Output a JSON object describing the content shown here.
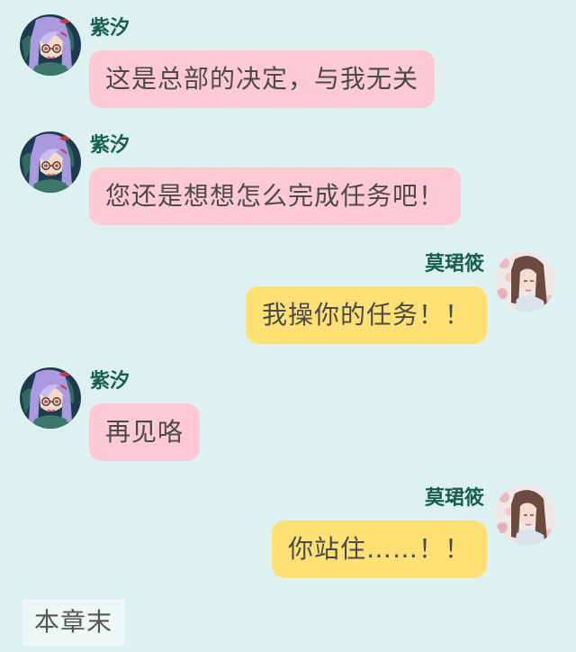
{
  "characters": {
    "zixi": {
      "name": "紫汐",
      "avatar_icon": "purple-hair-girl-avatar-icon"
    },
    "mojunxiao": {
      "name": "莫珺筱",
      "avatar_icon": "brown-hair-girl-avatar-icon"
    }
  },
  "messages": [
    {
      "sender": "紫汐",
      "side": "left",
      "text": "这是总部的决定，与我无关",
      "bubble_color": "#ffcad5"
    },
    {
      "sender": "紫汐",
      "side": "left",
      "text": "您还是想想怎么完成任务吧！",
      "bubble_color": "#ffcad5"
    },
    {
      "sender": "莫珺筱",
      "side": "right",
      "text": "我操你的任务！！",
      "bubble_color": "#ffe074"
    },
    {
      "sender": "紫汐",
      "side": "left",
      "text": "再见咯",
      "bubble_color": "#ffcad5"
    },
    {
      "sender": "莫珺筱",
      "side": "right",
      "text": "你站住……！！",
      "bubble_color": "#ffe074"
    }
  ],
  "footer": {
    "end_label": "本章末"
  },
  "colors": {
    "background": "#def1f1",
    "name_text": "#17604f",
    "left_bubble": "#ffcad5",
    "right_bubble": "#ffe074"
  }
}
